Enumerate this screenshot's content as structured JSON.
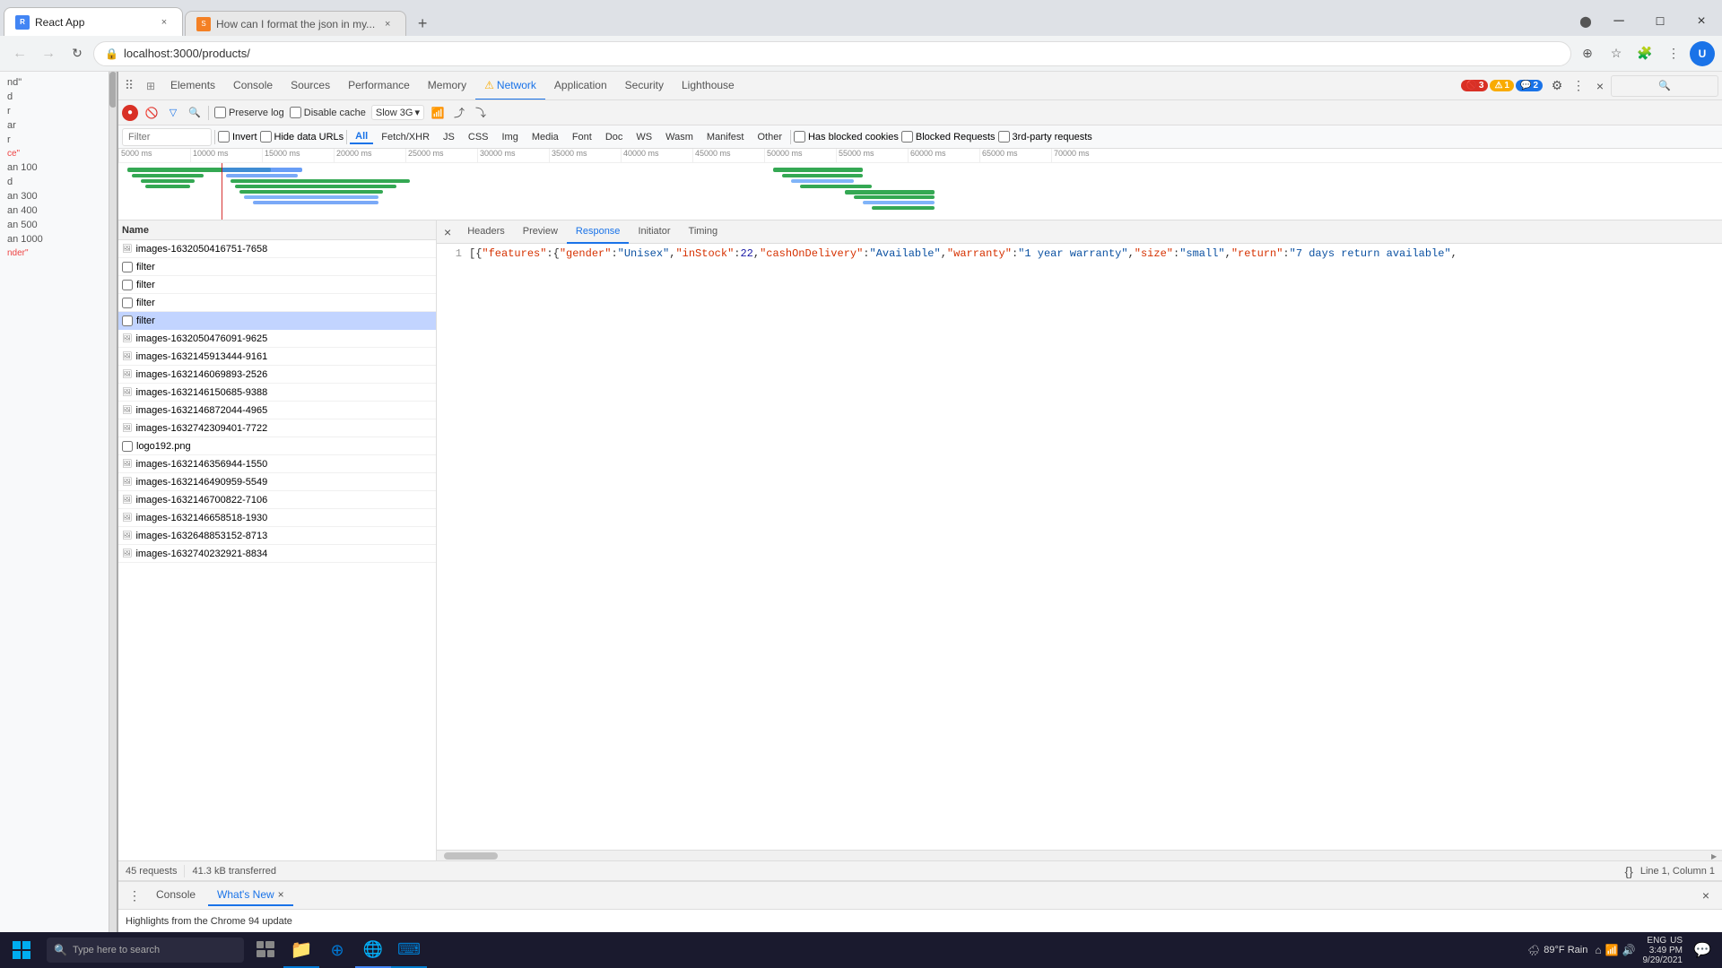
{
  "browser": {
    "tabs": [
      {
        "id": "tab1",
        "title": "React App",
        "favicon": "R",
        "active": true
      },
      {
        "id": "tab2",
        "title": "How can I format the json in my...",
        "favicon": "?",
        "active": false
      }
    ],
    "address": "localhost:3000/products/",
    "new_tab_label": "+",
    "close_label": "×"
  },
  "devtools": {
    "tabs": [
      {
        "label": "Elements",
        "active": false
      },
      {
        "label": "Console",
        "active": false
      },
      {
        "label": "Sources",
        "active": false
      },
      {
        "label": "Performance",
        "active": false
      },
      {
        "label": "Memory",
        "active": false
      },
      {
        "label": "Network",
        "active": true
      },
      {
        "label": "Application",
        "active": false
      },
      {
        "label": "Security",
        "active": false
      },
      {
        "label": "Lighthouse",
        "active": false
      }
    ],
    "badges": {
      "error": "3",
      "warning": "1",
      "info": "2"
    }
  },
  "network_toolbar": {
    "preserve_log": "Preserve log",
    "disable_cache": "Disable cache",
    "throttle": "Slow 3G"
  },
  "filter_bar": {
    "filter_placeholder": "Filter",
    "invert": "Invert",
    "hide_data_urls": "Hide data URLs",
    "types": [
      "All",
      "Fetch/XHR",
      "JS",
      "CSS",
      "Img",
      "Media",
      "Font",
      "Doc",
      "WS",
      "Wasm",
      "Manifest",
      "Other"
    ],
    "active_type": "All",
    "has_blocked_cookies": "Has blocked cookies",
    "blocked_requests": "Blocked Requests",
    "third_party": "3rd-party requests"
  },
  "timeline": {
    "marks": [
      "5000 ms",
      "10000 ms",
      "15000 ms",
      "20000 ms",
      "25000 ms",
      "30000 ms",
      "35000 ms",
      "40000 ms",
      "45000 ms",
      "50000 ms",
      "55000 ms",
      "60000 ms",
      "65000 ms",
      "70000 ms"
    ]
  },
  "request_list": {
    "header": "Name",
    "items": [
      {
        "name": "images-1632050416751-7658",
        "type": "image",
        "selected": false
      },
      {
        "name": "filter",
        "type": "fetch",
        "selected": false
      },
      {
        "name": "filter",
        "type": "fetch",
        "selected": false
      },
      {
        "name": "filter",
        "type": "fetch",
        "selected": false
      },
      {
        "name": "filter",
        "type": "fetch",
        "selected": true
      },
      {
        "name": "images-1632050476091-9625",
        "type": "image",
        "selected": false
      },
      {
        "name": "images-1632145913444-9161",
        "type": "image",
        "selected": false
      },
      {
        "name": "images-1632146069893-2526",
        "type": "image",
        "selected": false
      },
      {
        "name": "images-1632146150685-9388",
        "type": "image",
        "selected": false
      },
      {
        "name": "images-1632146872044-4965",
        "type": "image",
        "selected": false
      },
      {
        "name": "images-1632742309401-7722",
        "type": "image",
        "selected": false
      },
      {
        "name": "logo192.png",
        "type": "png",
        "selected": false
      },
      {
        "name": "images-1632146356944-1550",
        "type": "image",
        "selected": false
      },
      {
        "name": "images-1632146490959-5549",
        "type": "image",
        "selected": false
      },
      {
        "name": "images-1632146700822-7106",
        "type": "image",
        "selected": false
      },
      {
        "name": "images-1632146658518-1930",
        "type": "image",
        "selected": false
      },
      {
        "name": "images-1632648853152-8713",
        "type": "image",
        "selected": false
      },
      {
        "name": "images-1632740232921-8834",
        "type": "image",
        "selected": false
      }
    ]
  },
  "detail_tabs": [
    "Headers",
    "Preview",
    "Response",
    "Initiator",
    "Timing"
  ],
  "active_detail_tab": "Response",
  "response": {
    "line_number": "1",
    "content": "[{\"features\":{\"gender\":\"Unisex\",\"inStock\":22,\"cashOnDelivery\":\"Available\",\"warranty\":\"1 year warranty\",\"size\":\"small\",\"return\":\"7 days return available\","
  },
  "status_bar": {
    "requests": "45 requests",
    "transferred": "41.3 kB transferred",
    "line_col": "Line 1, Column 1"
  },
  "console_bar": {
    "console_label": "Console",
    "whats_new_label": "What's New",
    "highlights_label": "Highlights from the Chrome 94 update"
  },
  "webpage_sidebar": {
    "items": [
      "nd\"",
      "d",
      "r",
      "ar",
      "r",
      "ce\"",
      "an 100",
      "d",
      "an 300",
      "an 400",
      "an 500",
      "an 1000",
      "nder\""
    ]
  },
  "taskbar": {
    "search_placeholder": "Type here to search",
    "weather": "89°F Rain",
    "language": "ENG",
    "region": "US",
    "time": "3:49 PM",
    "date": "9/29/2021"
  }
}
